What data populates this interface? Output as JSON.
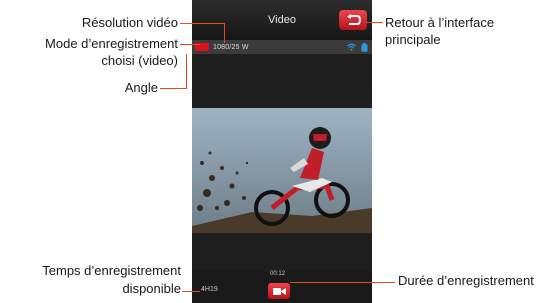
{
  "screen": {
    "title": "Video",
    "resolution": "1080/25 W",
    "time_available": "4H19",
    "recording_duration": "00:12"
  },
  "callouts": {
    "resolution": "Résolution vidéo",
    "mode_line1": "Mode d’enregistrement",
    "mode_line2": "choisi (video)",
    "angle": "Angle",
    "back_line1": "Retour à l’interface",
    "back_line2": "principale",
    "time_line1": "Temps d’enregistrement",
    "time_line2": "disponible",
    "duration": "Durée d’enregistrement"
  },
  "colors": {
    "accent_red": "#d8121e",
    "leader_orange": "#e84a1f",
    "status_blue": "#2a9be0"
  },
  "icons": {
    "back": "return-arrow-icon",
    "record": "video-camera-icon",
    "mode": "video-mode-icon",
    "wifi": "wifi-icon",
    "battery": "battery-icon"
  }
}
